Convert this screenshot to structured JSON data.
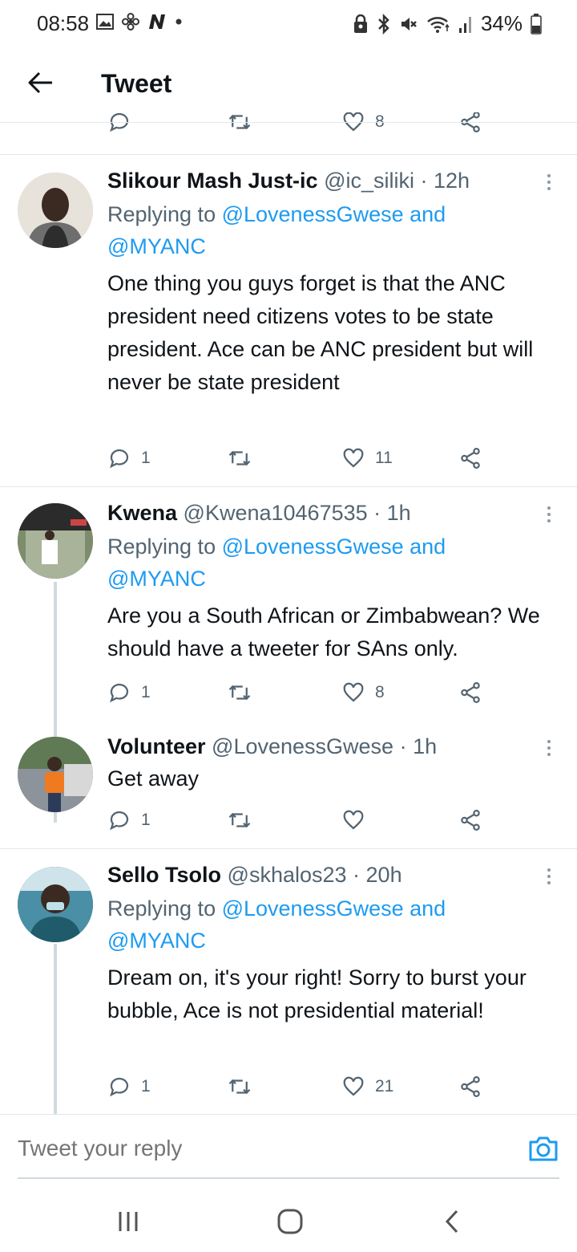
{
  "status_bar": {
    "time": "08:58",
    "battery": "34%",
    "left_icons": [
      "image-icon",
      "fan-icon",
      "n-icon",
      "dot-icon"
    ],
    "right_icons": [
      "lock-icon",
      "bluetooth-icon",
      "mute-icon",
      "wifi-icon",
      "signal-icon",
      "battery-icon"
    ]
  },
  "app_bar": {
    "title": "Tweet"
  },
  "prev_actions": {
    "like_count": "8"
  },
  "tweets": [
    {
      "name": "Slikour Mash Just-ic",
      "handle": "@ic_siliki",
      "time": "· 12h",
      "replying_prefix": "Replying to ",
      "replying_mention1": "@LovenessGwese",
      "replying_and": " and",
      "replying_mention2": "@MYANC",
      "body": "One thing you guys forget is that the ANC president need citizens votes to be state president. Ace can be ANC president but will never be state president",
      "reply_count": "1",
      "retweet_count": "",
      "like_count": "11"
    },
    {
      "name": "Kwena",
      "handle": "@Kwena10467535",
      "time": "· 1h",
      "replying_prefix": "Replying to ",
      "replying_mention1": "@LovenessGwese",
      "replying_and": " and",
      "replying_mention2": "@MYANC",
      "body": "Are you a South African or Zimbabwean? We should have a tweeter for SAns only.",
      "reply_count": "1",
      "retweet_count": "",
      "like_count": "8"
    },
    {
      "name": "Volunteer",
      "handle": "@LovenessGwese",
      "time": "· 1h",
      "body": "Get away",
      "reply_count": "1",
      "retweet_count": "",
      "like_count": ""
    },
    {
      "name": "Sello Tsolo",
      "handle": "@skhalos23",
      "time": "· 20h",
      "replying_prefix": "Replying to ",
      "replying_mention1": "@LovenessGwese",
      "replying_and": " and",
      "replying_mention2": "@MYANC",
      "body": "Dream on, it's your right! Sorry to burst your bubble, Ace is not presidential material!",
      "reply_count": "1",
      "retweet_count": "",
      "like_count": "21"
    }
  ],
  "reply_bar": {
    "placeholder": "Tweet your reply"
  },
  "colors": {
    "accent": "#1d9bf0",
    "text": "#0f1419",
    "muted": "#536471",
    "divider": "#e1e8ed"
  }
}
